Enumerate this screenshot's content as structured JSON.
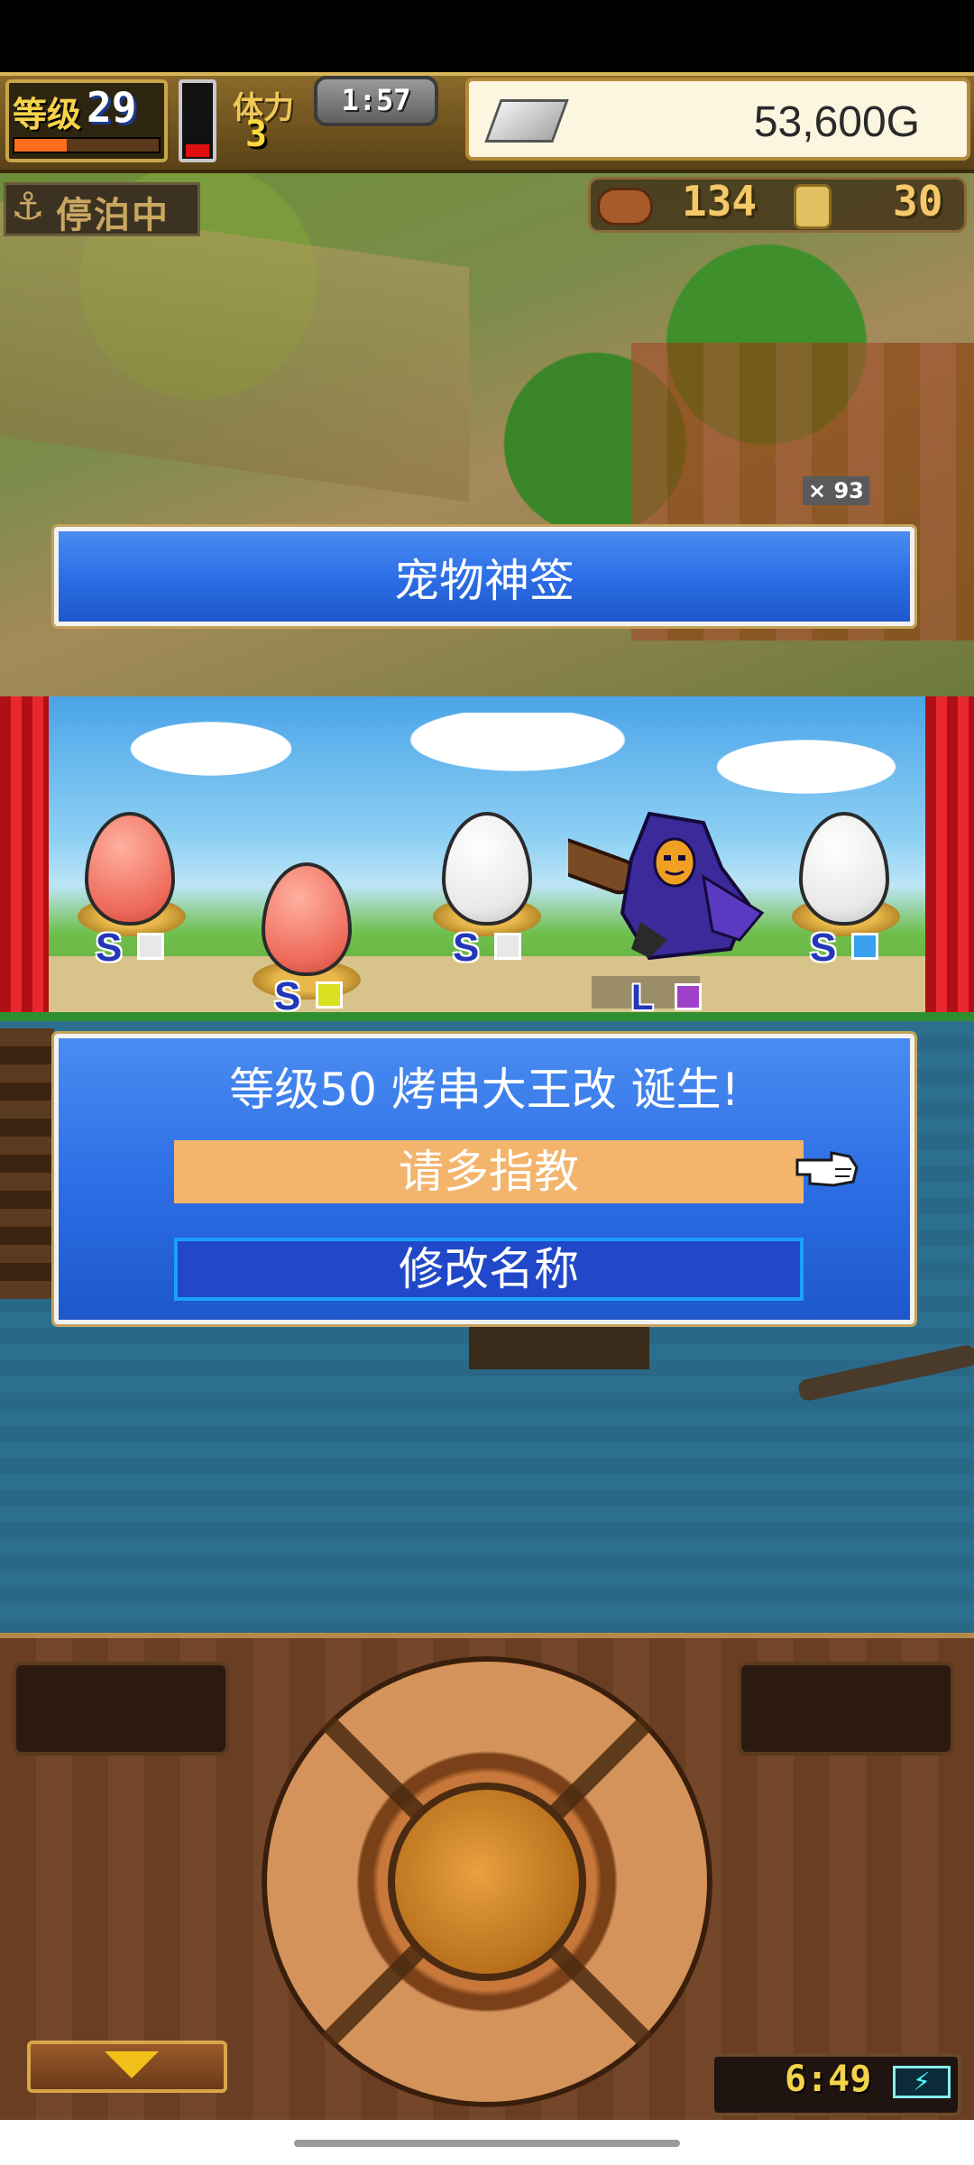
{
  "hud": {
    "level_label": "等级",
    "level": "29",
    "hp_label": "体力",
    "hp": "3",
    "timer": "1:57",
    "gold": "53,600G",
    "xp_fraction": 0.36,
    "stamina_fraction": 0.18
  },
  "status": {
    "dock_icon": "⚓",
    "dock_label": "停泊中",
    "meat": "134",
    "coins": "30",
    "count_badge": "× 93"
  },
  "title_banner": "宠物神签",
  "eggs": [
    {
      "color": "pink",
      "rank": "S",
      "gem": "white"
    },
    {
      "color": "pink",
      "rank": "S",
      "gem": "yellow"
    },
    {
      "color": "white",
      "rank": "S",
      "gem": "white"
    },
    {
      "color": "white",
      "rank": "S",
      "gem": "blue"
    }
  ],
  "monster": {
    "rank": "L",
    "gem": "purple",
    "icon": "hooded-reaper-icon"
  },
  "dialog": {
    "message": "等级50 烤串大王改 诞生!",
    "confirm_label": "请多指教",
    "rename_label": "修改名称"
  },
  "footer": {
    "clock": "6:49",
    "battery_icon": "⚡"
  },
  "colors": {
    "panel_blue": "#2d6fe6",
    "confirm_orange": "#f3b46c",
    "rename_border": "#1aa0ff",
    "gold_text": "#f5c96a"
  }
}
